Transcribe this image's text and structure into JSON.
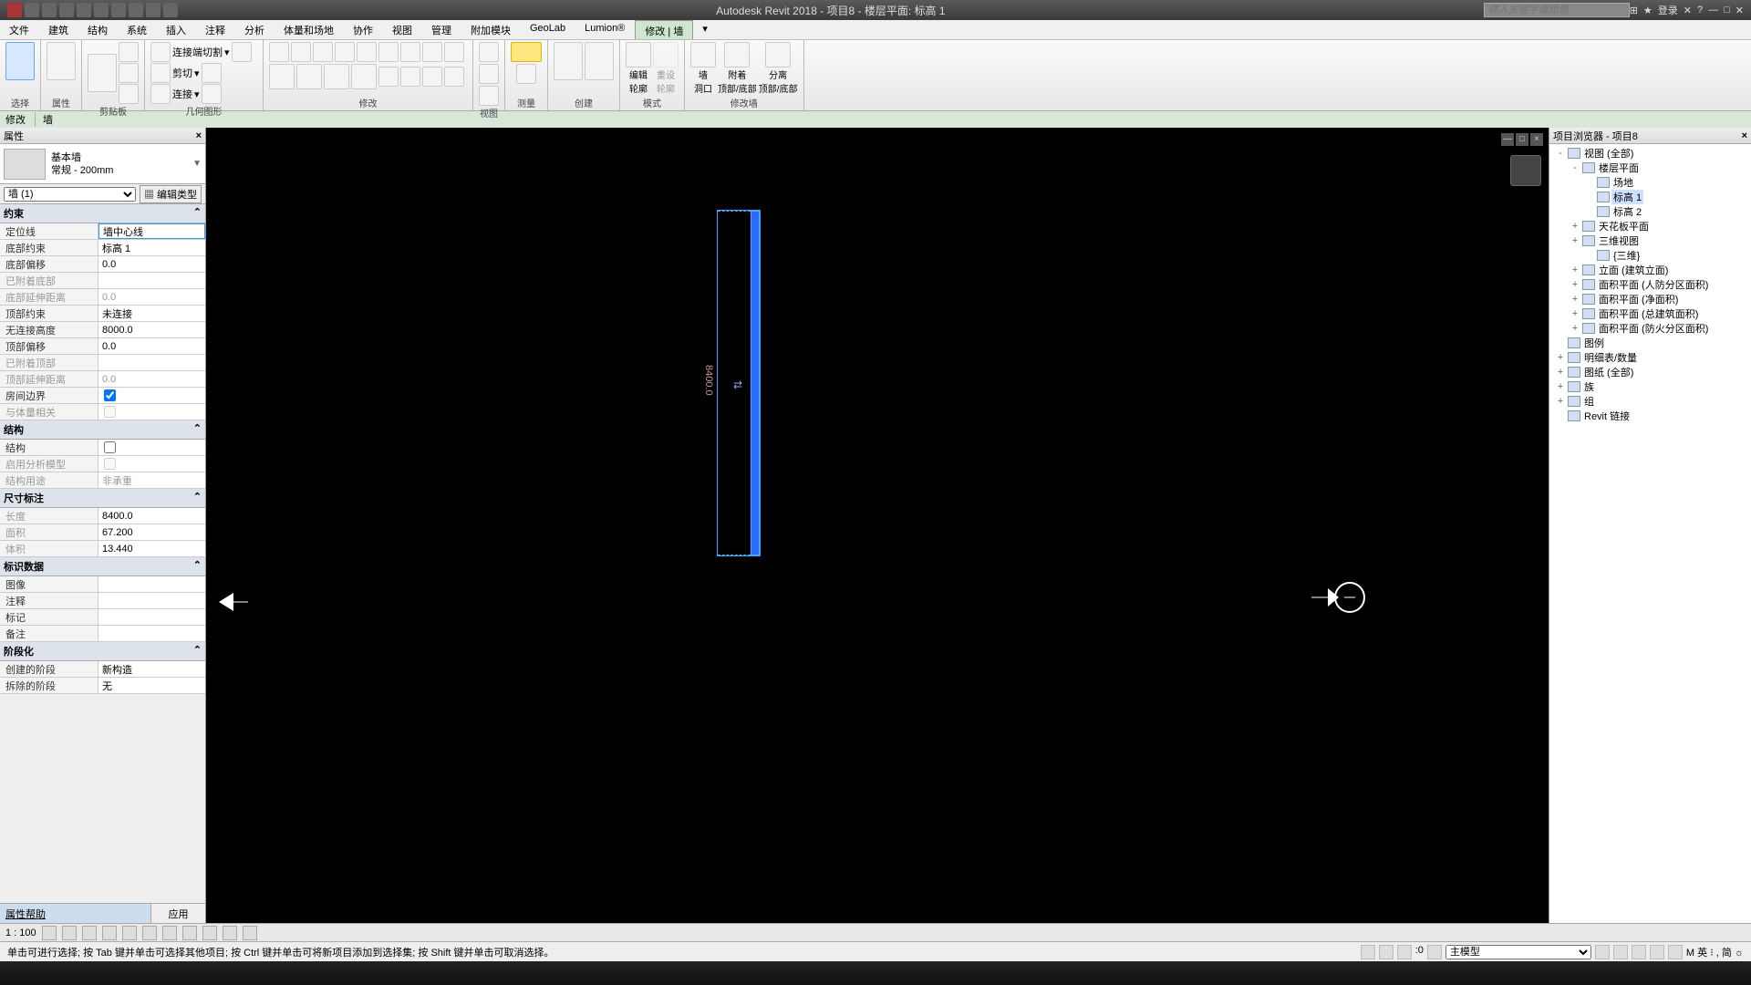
{
  "app": {
    "title": "Autodesk Revit 2018 -    项目8 - 楼层平面: 标高 1",
    "search_placeholder": "键入关键字或短语",
    "login": "登录"
  },
  "menu": {
    "items": [
      "文件",
      "建筑",
      "结构",
      "系统",
      "插入",
      "注释",
      "分析",
      "体量和场地",
      "协作",
      "视图",
      "管理",
      "附加模块",
      "GeoLab",
      "Lumion®",
      "修改 | 墙"
    ],
    "active_index": 14
  },
  "ribbon": {
    "groups": [
      "选择",
      "属性",
      "剪贴板",
      "几何图形",
      "修改",
      "视图",
      "测量",
      "创建",
      "模式",
      "修改墙"
    ],
    "mode_edit": "编辑\n轮廓",
    "mode_reset": "重设\n轮廓",
    "wall_opening": "墙\n洞口",
    "attach": "附着\n顶部/底部",
    "detach": "分离\n顶部/底部",
    "join_cut": "连接端切割",
    "cut": "剪切",
    "join": "连接"
  },
  "context_bar": {
    "a": "修改",
    "b": "墙"
  },
  "props": {
    "title": "属性",
    "type_family": "基本墙",
    "type_name": "常规 - 200mm",
    "instance_filter": "墙 (1)",
    "edit_type": "编辑类型",
    "groups": {
      "constraints": "约束",
      "structural": "结构",
      "dimensions": "尺寸标注",
      "identity": "标识数据",
      "phasing": "阶段化"
    },
    "rows": {
      "location_line": {
        "k": "定位线",
        "v": "墙中心线"
      },
      "base_constraint": {
        "k": "底部约束",
        "v": "标高 1"
      },
      "base_offset": {
        "k": "底部偏移",
        "v": "0.0"
      },
      "base_attached": {
        "k": "已附着底部",
        "v": ""
      },
      "base_ext": {
        "k": "底部延伸距离",
        "v": "0.0"
      },
      "top_constraint": {
        "k": "顶部约束",
        "v": "未连接"
      },
      "unconnected_h": {
        "k": "无连接高度",
        "v": "8000.0"
      },
      "top_offset": {
        "k": "顶部偏移",
        "v": "0.0"
      },
      "top_attached": {
        "k": "已附着顶部",
        "v": ""
      },
      "top_ext": {
        "k": "顶部延伸距离",
        "v": "0.0"
      },
      "room_bounding": {
        "k": "房间边界",
        "v": true
      },
      "mass_related": {
        "k": "与体量相关",
        "v": false
      },
      "structural": {
        "k": "结构",
        "v": false
      },
      "analytical": {
        "k": "启用分析模型",
        "v": ""
      },
      "structural_usage": {
        "k": "结构用途",
        "v": "非承重"
      },
      "length": {
        "k": "长度",
        "v": "8400.0"
      },
      "area": {
        "k": "面积",
        "v": "67.200"
      },
      "volume": {
        "k": "体积",
        "v": "13.440"
      },
      "image": {
        "k": "图像",
        "v": ""
      },
      "comments": {
        "k": "注释",
        "v": ""
      },
      "mark": {
        "k": "标记",
        "v": ""
      },
      "note": {
        "k": "备注",
        "v": ""
      },
      "phase_created": {
        "k": "创建的阶段",
        "v": "新构造"
      },
      "phase_demolished": {
        "k": "拆除的阶段",
        "v": "无"
      }
    },
    "help": "属性帮助",
    "apply": "应用"
  },
  "canvas": {
    "dimension": "8400.0",
    "flip": "⇄"
  },
  "browser": {
    "title": "项目浏览器 - 项目8",
    "nodes": [
      {
        "indent": 0,
        "exp": "-",
        "label": "视图 (全部)"
      },
      {
        "indent": 1,
        "exp": "-",
        "label": "楼层平面"
      },
      {
        "indent": 2,
        "exp": "",
        "label": "场地"
      },
      {
        "indent": 2,
        "exp": "",
        "label": "标高 1",
        "sel": true
      },
      {
        "indent": 2,
        "exp": "",
        "label": "标高 2"
      },
      {
        "indent": 1,
        "exp": "+",
        "label": "天花板平面"
      },
      {
        "indent": 1,
        "exp": "+",
        "label": "三维视图"
      },
      {
        "indent": 2,
        "exp": "",
        "label": "{三维}"
      },
      {
        "indent": 1,
        "exp": "+",
        "label": "立面 (建筑立面)"
      },
      {
        "indent": 1,
        "exp": "+",
        "label": "面积平面 (人防分区面积)"
      },
      {
        "indent": 1,
        "exp": "+",
        "label": "面积平面 (净面积)"
      },
      {
        "indent": 1,
        "exp": "+",
        "label": "面积平面 (总建筑面积)"
      },
      {
        "indent": 1,
        "exp": "+",
        "label": "面积平面 (防火分区面积)"
      },
      {
        "indent": 0,
        "exp": "",
        "label": "图例"
      },
      {
        "indent": 0,
        "exp": "+",
        "label": "明细表/数量"
      },
      {
        "indent": 0,
        "exp": "+",
        "label": "图纸 (全部)"
      },
      {
        "indent": 0,
        "exp": "+",
        "label": "族"
      },
      {
        "indent": 0,
        "exp": "+",
        "label": "组"
      },
      {
        "indent": 0,
        "exp": "",
        "label": "Revit 链接"
      }
    ]
  },
  "viewbar": {
    "scale": "1 : 100"
  },
  "status": {
    "hint": "单击可进行选择; 按 Tab 键并单击可选择其他项目; 按 Ctrl 键并单击可将新项目添加到选择集; 按 Shift 键并单击可取消选择。",
    "coord": ":0",
    "model": "主模型",
    "ime": "M 英 ⁝ , 简 ☼"
  }
}
